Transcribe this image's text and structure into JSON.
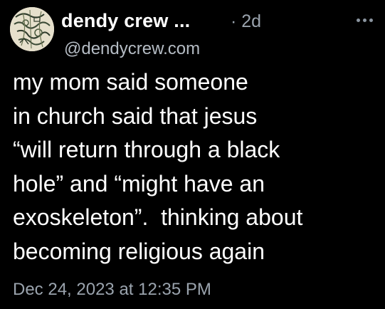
{
  "author": {
    "display_name": "dendy crew ...",
    "handle": "@dendycrew.com",
    "avatar_icon": "sketch-avatar-icon"
  },
  "post": {
    "time_ago": "· 2d",
    "lines": [
      "my mom said someone",
      "in church said that jesus",
      "“will return through a black",
      "hole” and “might have an",
      "exoskeleton”.  thinking about",
      "becoming religious again"
    ],
    "date": "Dec 24, 2023 at 12:35 PM"
  },
  "menu": {
    "icon": "more-horizontal-icon"
  },
  "colors": {
    "background": "#000000",
    "text": "#ffffff",
    "muted": "#9aa3ad",
    "handle": "#b5bcc4"
  }
}
